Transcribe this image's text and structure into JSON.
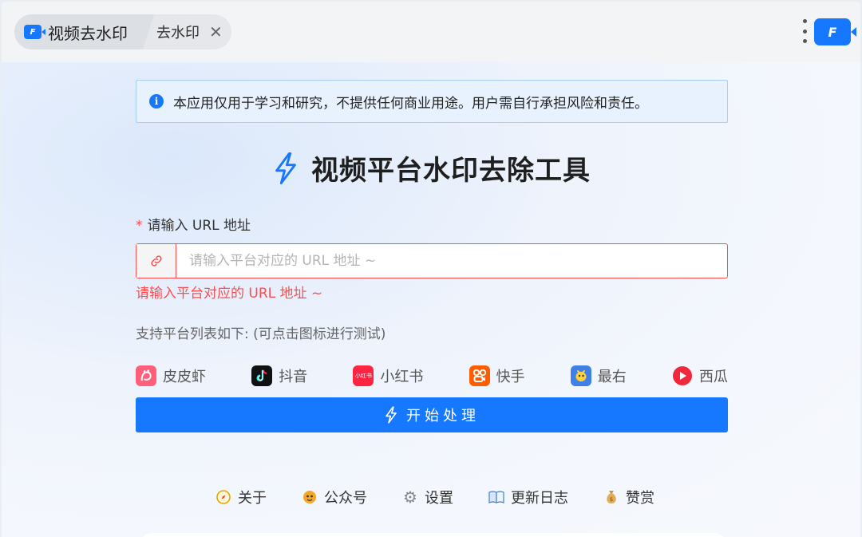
{
  "tabs": {
    "active": {
      "title": "视频去水印"
    },
    "second": {
      "title": "去水印"
    }
  },
  "notice": {
    "text": "本应用仅用于学习和研究，不提供任何商业用途。用户需自行承担风险和责任。"
  },
  "main": {
    "title": "视频平台水印去除工具"
  },
  "form": {
    "label": "请输入 URL 地址",
    "required_mark": "*",
    "placeholder": "请输入平台对应的 URL 地址 ~",
    "value": "",
    "error": "请输入平台对应的 URL 地址 ~"
  },
  "support_text": "支持平台列表如下: (可点击图标进行测试)",
  "platforms": [
    {
      "label": "皮皮虾",
      "icon": "pipixia-icon",
      "color": "#ff5f7a"
    },
    {
      "label": "抖音",
      "icon": "douyin-icon",
      "color": "#111111"
    },
    {
      "label": "小红书",
      "icon": "xiaohongshu-icon",
      "color": "#ff2442",
      "icon_text": "小红书"
    },
    {
      "label": "快手",
      "icon": "kuaishou-icon",
      "color": "#ff5b00"
    },
    {
      "label": "最右",
      "icon": "zuiyou-icon",
      "color": "#3f7fe8"
    },
    {
      "label": "西瓜",
      "icon": "xigua-icon",
      "color": "#f0283c"
    }
  ],
  "start_button": {
    "label": "开始处理"
  },
  "footer_links": [
    {
      "label": "关于",
      "icon": "compass-icon"
    },
    {
      "label": "公众号",
      "icon": "mascot-icon"
    },
    {
      "label": "设置",
      "icon": "gear-icon"
    },
    {
      "label": "更新日志",
      "icon": "book-icon"
    },
    {
      "label": "赞赏",
      "icon": "money-bag-icon"
    }
  ],
  "colors": {
    "accent": "#1677ff",
    "error": "#ff4d4f",
    "notice_bg": "#e8f2fe"
  }
}
